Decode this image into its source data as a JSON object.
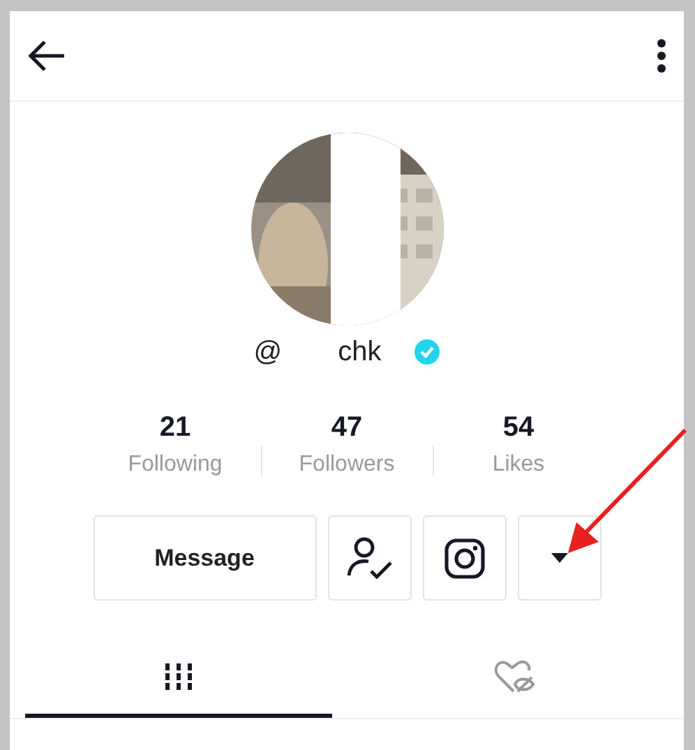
{
  "header": {
    "back": true,
    "menu": true
  },
  "profile": {
    "username_prefix": "@",
    "username_visible": "chk",
    "verified": true
  },
  "stats": [
    {
      "value": "21",
      "label": "Following"
    },
    {
      "value": "47",
      "label": "Followers"
    },
    {
      "value": "54",
      "label": "Likes"
    }
  ],
  "actions": [
    {
      "kind": "text",
      "label": "Message"
    },
    {
      "kind": "following"
    },
    {
      "kind": "instagram"
    },
    {
      "kind": "dropdown"
    }
  ],
  "tabs": [
    {
      "kind": "videos",
      "selected": true
    },
    {
      "kind": "liked",
      "selected": false
    }
  ]
}
